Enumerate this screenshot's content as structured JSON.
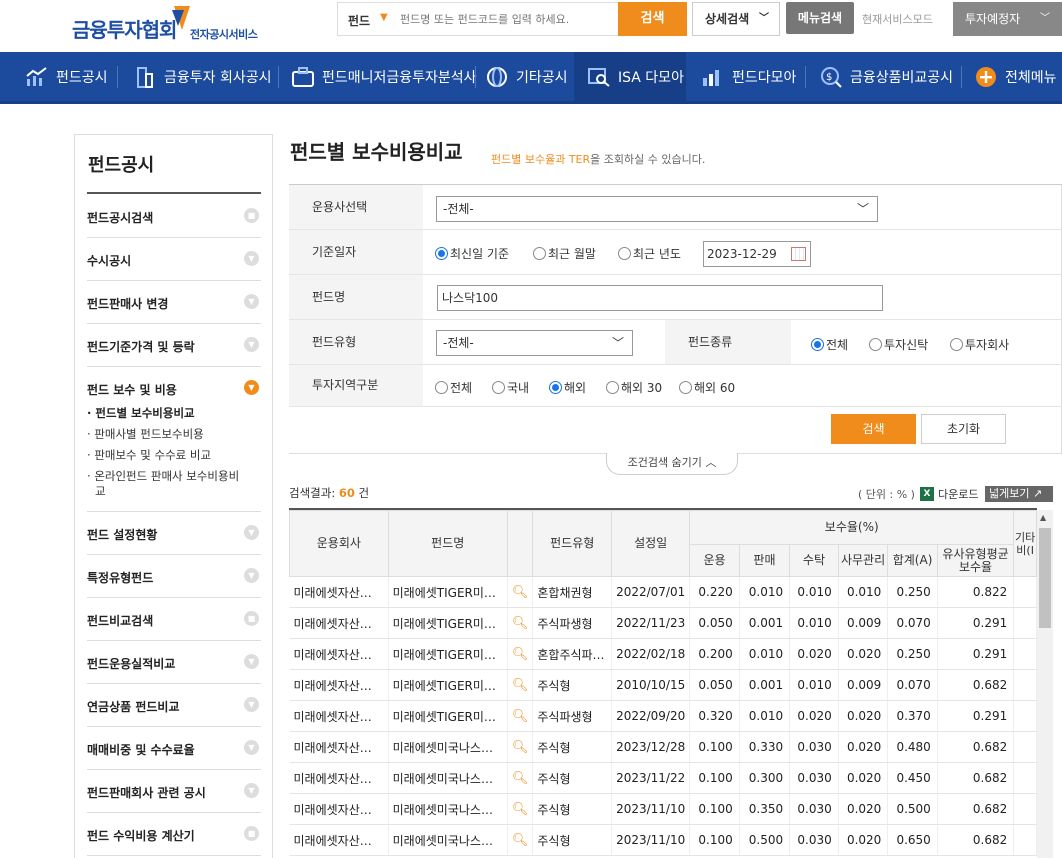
{
  "header": {
    "logo_text": "금융투자협회",
    "logo_sub": "전자공시서비스",
    "search_category": "펀드",
    "search_placeholder": "펀드명 또는 펀드코드를 입력 하세요.",
    "search_button": "검색",
    "advanced_search": "상세검색",
    "menu_search": "메뉴검색",
    "mode_label": "현재서비스모드",
    "mode_value": "투자예정자"
  },
  "nav": [
    "펀드공시",
    "금융투자 회사공시",
    "펀드매니저금융투자분석사",
    "기타공시",
    "ISA 다모아",
    "펀드다모아",
    "금융상품비교공시",
    "전체메뉴"
  ],
  "sidebar": {
    "title": "펀드공시",
    "items": [
      "펀드공시검색",
      "수시공시",
      "펀드판매사 변경",
      "펀드기준가격 및 등락",
      "펀드 보수 및 비용",
      "펀드 설정현황",
      "특정유형펀드",
      "펀드비교검색",
      "펀드운용실적비교",
      "연금상품 펀드비교",
      "매매비중 및 수수료율",
      "펀드판매회사 관련 공시",
      "펀드 수익비용 계산기"
    ],
    "subitems": [
      "펀드별 보수비용비교",
      "판매사별 펀드보수비용",
      "판매보수 및 수수료 비교",
      "온라인펀드 판매사 보수비용비",
      "교"
    ]
  },
  "page": {
    "title": "펀드별 보수비용비교",
    "desc_highlight": "펀드별 보수율과 TER",
    "desc_rest": "을 조회하실 수 있습니다."
  },
  "form": {
    "company_label": "운용사선택",
    "company_value": "-전체-",
    "date_label": "기준일자",
    "date_options": [
      "최신일 기준",
      "최근 월말",
      "최근 년도"
    ],
    "date_value": "2023-12-29",
    "fund_name_label": "펀드명",
    "fund_name_value": "나스닥100",
    "fund_type_label": "펀드유형",
    "fund_type_value": "-전체-",
    "fund_kind_label": "펀드종류",
    "fund_kind_options": [
      "전체",
      "투자신탁",
      "투자회사"
    ],
    "region_label": "투자지역구분",
    "region_options": [
      "전체",
      "국내",
      "해외",
      "해외 30",
      "해외 60"
    ],
    "search_button": "검색",
    "reset_button": "초기화",
    "toggle_label": "조건검색 숨기기"
  },
  "result": {
    "label": "검색결과:",
    "count": "60",
    "count_suffix": "건",
    "unit": "( 단위 : % )",
    "download": "다운로드",
    "wide_view": "넓게보기"
  },
  "table": {
    "headers": {
      "company": "운용회사",
      "fund": "펀드명",
      "type": "펀드유형",
      "setup": "설정일",
      "fee_group": "보수율(%)",
      "op": "운용",
      "sale": "판매",
      "trust": "수탁",
      "admin": "사무관리",
      "total": "합계(A)",
      "similar": "유사유형평균보수율",
      "extra": "기타비(I"
    },
    "rows": [
      {
        "company": "미래에셋자산…",
        "fund": "미래에셋TIGER미…",
        "type": "혼합채권형",
        "setup": "2022/07/01",
        "op": "0.220",
        "sale": "0.010",
        "trust": "0.010",
        "admin": "0.010",
        "total": "0.250",
        "similar": "0.822"
      },
      {
        "company": "미래에셋자산…",
        "fund": "미래에셋TIGER미…",
        "type": "주식파생형",
        "setup": "2022/11/23",
        "op": "0.050",
        "sale": "0.001",
        "trust": "0.010",
        "admin": "0.009",
        "total": "0.070",
        "similar": "0.291"
      },
      {
        "company": "미래에셋자산…",
        "fund": "미래에셋TIGER미…",
        "type": "혼합주식파…",
        "setup": "2022/02/18",
        "op": "0.200",
        "sale": "0.010",
        "trust": "0.020",
        "admin": "0.020",
        "total": "0.250",
        "similar": "0.291"
      },
      {
        "company": "미래에셋자산…",
        "fund": "미래에셋TIGER미…",
        "type": "주식형",
        "setup": "2010/10/15",
        "op": "0.050",
        "sale": "0.001",
        "trust": "0.010",
        "admin": "0.009",
        "total": "0.070",
        "similar": "0.682"
      },
      {
        "company": "미래에셋자산…",
        "fund": "미래에셋TIGER미…",
        "type": "주식파생형",
        "setup": "2022/09/20",
        "op": "0.320",
        "sale": "0.010",
        "trust": "0.020",
        "admin": "0.020",
        "total": "0.370",
        "similar": "0.291"
      },
      {
        "company": "미래에셋자산…",
        "fund": "미래에셋미국나스…",
        "type": "주식형",
        "setup": "2023/12/28",
        "op": "0.100",
        "sale": "0.330",
        "trust": "0.030",
        "admin": "0.020",
        "total": "0.480",
        "similar": "0.682"
      },
      {
        "company": "미래에셋자산…",
        "fund": "미래에셋미국나스…",
        "type": "주식형",
        "setup": "2023/11/22",
        "op": "0.100",
        "sale": "0.300",
        "trust": "0.030",
        "admin": "0.020",
        "total": "0.450",
        "similar": "0.682"
      },
      {
        "company": "미래에셋자산…",
        "fund": "미래에셋미국나스…",
        "type": "주식형",
        "setup": "2023/11/10",
        "op": "0.100",
        "sale": "0.350",
        "trust": "0.030",
        "admin": "0.020",
        "total": "0.500",
        "similar": "0.682"
      },
      {
        "company": "미래에셋자산…",
        "fund": "미래에셋미국나스…",
        "type": "주식형",
        "setup": "2023/11/10",
        "op": "0.100",
        "sale": "0.500",
        "trust": "0.030",
        "admin": "0.020",
        "total": "0.650",
        "similar": "0.682"
      }
    ]
  },
  "colors": {
    "brand": "#1c4b9e",
    "accent": "#f08c1c"
  }
}
